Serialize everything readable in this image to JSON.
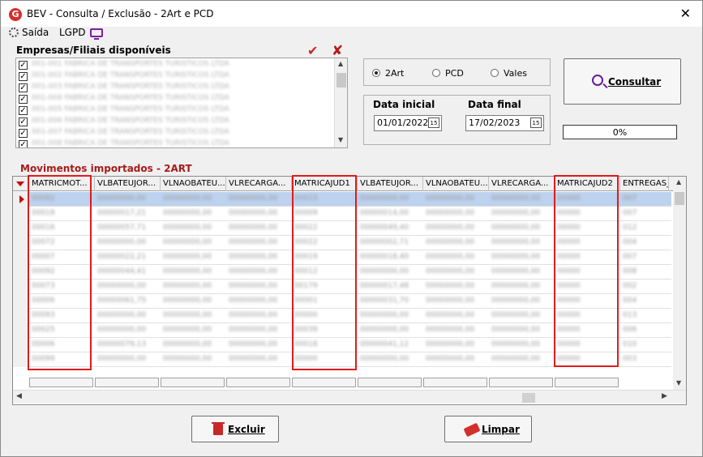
{
  "window": {
    "title": "BEV - Consulta / Exclusão - 2Art e PCD",
    "app_icon": "G"
  },
  "menu": {
    "exit_label": "Saída",
    "lgpd_label": "LGPD"
  },
  "companies": {
    "label": "Empresas/Filiais disponíveis",
    "items": [
      {
        "checked": true,
        "name": "001-001 FABRICA DE TRANSPORTES TURISTICOS LTDA"
      },
      {
        "checked": true,
        "name": "001-002 FABRICA DE TRANSPORTES TURISTICOS LTDA"
      },
      {
        "checked": true,
        "name": "001-003 FABRICA DE TRANSPORTES TURISTICOS LTDA"
      },
      {
        "checked": true,
        "name": "001-004 FABRICA DE TRANSPORTES TURISTICOS LTDA"
      },
      {
        "checked": true,
        "name": "001-005 FABRICA DE TRANSPORTES TURISTICOS LTDA"
      },
      {
        "checked": true,
        "name": "001-006 FABRICA DE TRANSPORTES TURISTICOS LTDA"
      },
      {
        "checked": true,
        "name": "001-007 FABRICA DE TRANSPORTES TURISTICOS LTDA"
      },
      {
        "checked": true,
        "name": "001-008 FABRICA DE TRANSPORTES TURISTICOS LTDA"
      }
    ]
  },
  "options": {
    "radios": [
      {
        "label": "2Art",
        "selected": true
      },
      {
        "label": "PCD",
        "selected": false
      },
      {
        "label": "Vales",
        "selected": false
      }
    ]
  },
  "dates": {
    "start_label": "Data inicial",
    "start_value": "01/01/2022",
    "end_label": "Data final",
    "end_value": "17/02/2023",
    "calendar_glyph": "15"
  },
  "consult": {
    "label": "Consultar"
  },
  "progress": {
    "text": "0%",
    "value": 0
  },
  "movements": {
    "label": "Movimentos importados - 2ART",
    "columns": [
      "MATRICMOT...",
      "VLBATEUJOR...",
      "VLNAOBATEU...",
      "VLRECARGA...",
      "MATRICAJUD1",
      "VLBATEUJOR...",
      "VLNAOBATEU...",
      "VLRECARGA...",
      "MATRICAJUD2",
      "ENTREGAS_"
    ],
    "rows": [
      [
        "00092",
        "00000000,00",
        "00000000,00",
        "00000000,00",
        "00015",
        "00000000,00",
        "00000000,00",
        "00000000,00",
        "00000",
        "007"
      ],
      [
        "00018",
        "00000017,21",
        "00000000,00",
        "00000000,00",
        "00009",
        "00000014,00",
        "00000000,00",
        "00000000,00",
        "00000",
        "007"
      ],
      [
        "00016",
        "00000057,71",
        "00000000,00",
        "00000000,00",
        "00022",
        "00000049,40",
        "00000000,00",
        "00000000,00",
        "00000",
        "012"
      ],
      [
        "00072",
        "00000000,00",
        "00000000,00",
        "00000000,00",
        "00022",
        "00000002,71",
        "00000000,00",
        "00000000,00",
        "00000",
        "004"
      ],
      [
        "00007",
        "00000022,21",
        "00000000,00",
        "00000000,00",
        "00019",
        "00000018,40",
        "00000000,00",
        "00000000,00",
        "00000",
        "007"
      ],
      [
        "00092",
        "00000044,41",
        "00000000,00",
        "00000000,00",
        "00012",
        "00000000,00",
        "00000000,00",
        "00000000,00",
        "00000",
        "008"
      ],
      [
        "00073",
        "00000000,00",
        "00000000,00",
        "00000000,00",
        "00179",
        "00000017,48",
        "00000000,00",
        "00000000,00",
        "00000",
        "002"
      ],
      [
        "00006",
        "00000061,75",
        "00000000,00",
        "00000000,00",
        "00001",
        "00000031,70",
        "00000000,00",
        "00000000,00",
        "00000",
        "004"
      ],
      [
        "00093",
        "00000000,00",
        "00000000,00",
        "00000000,00",
        "00000",
        "00000000,00",
        "00000000,00",
        "00000000,00",
        "00000",
        "013"
      ],
      [
        "00025",
        "00000000,00",
        "00000000,00",
        "00000000,00",
        "00039",
        "00000000,00",
        "00000000,00",
        "00000000,00",
        "00000",
        "006"
      ],
      [
        "00006",
        "00000079,13",
        "00000000,00",
        "00000000,00",
        "00018",
        "00000041,12",
        "00000000,00",
        "00000000,00",
        "00000",
        "010"
      ],
      [
        "00099",
        "00000000,00",
        "00000000,00",
        "00000000,00",
        "00000",
        "00000000,00",
        "00000000,00",
        "00000000,00",
        "00000",
        "003"
      ]
    ]
  },
  "actions": {
    "delete_label": "Excluir",
    "clear_label": "Limpar"
  },
  "colors": {
    "highlight_box": "#e01b1b",
    "section_label": "#a61b1b",
    "selected_row": "#bcd2ee",
    "accent_purple": "#6a1b9a"
  },
  "icons": {
    "app": "app-logo-icon",
    "exit": "gear-icon",
    "lgpd": "monitor-icon",
    "check_all": "check-icon",
    "uncheck_all": "x-icon",
    "consult": "search-icon",
    "delete": "trash-icon",
    "clear": "eraser-icon",
    "close": "close-icon"
  }
}
